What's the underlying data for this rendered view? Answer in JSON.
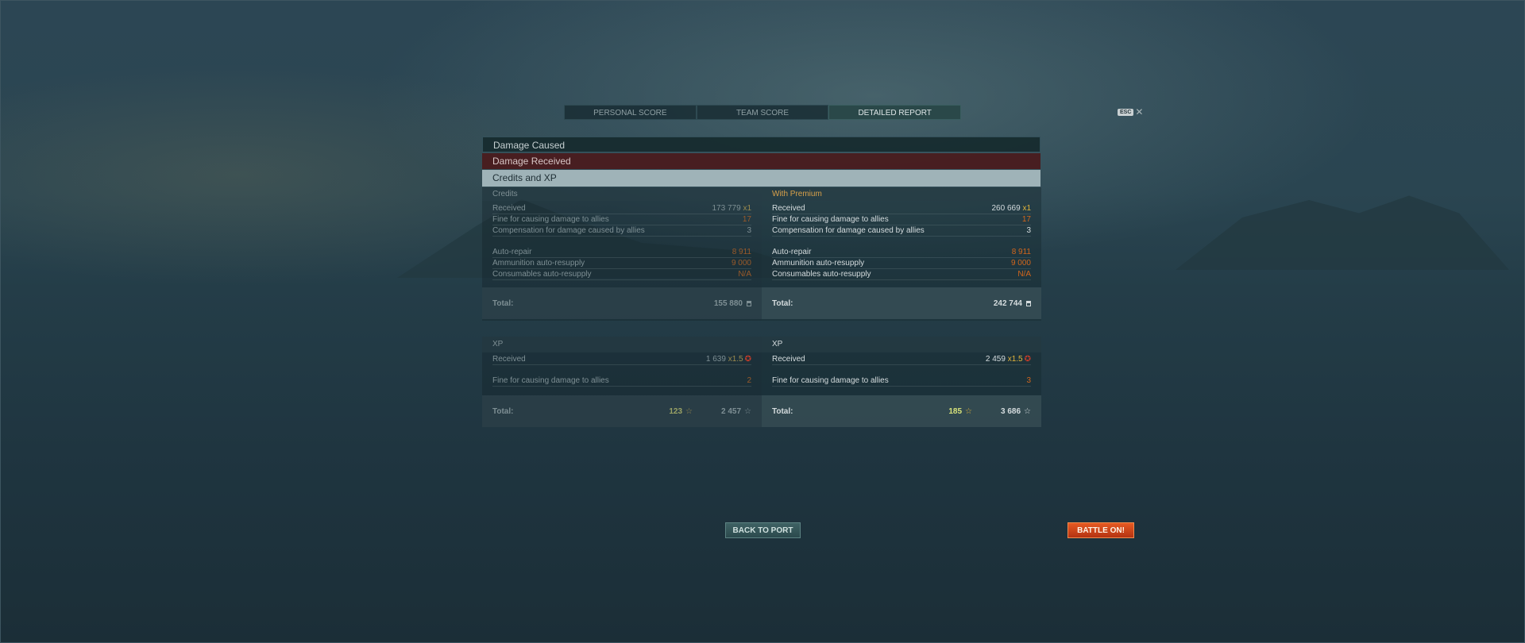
{
  "tabs": [
    {
      "label": "PERSONAL SCORE"
    },
    {
      "label": "TEAM SCORE"
    },
    {
      "label": "DETAILED REPORT"
    }
  ],
  "esc": {
    "key": "ESC",
    "close": "✕"
  },
  "sections": {
    "caused": "Damage Caused",
    "received": "Damage Received",
    "credits": "Credits and XP"
  },
  "credits": {
    "header": "Credits",
    "rows": [
      {
        "label": "Received",
        "value": "173 779",
        "mult": "x1"
      },
      {
        "label": "Fine for causing damage to allies",
        "value": "17"
      },
      {
        "label": "Compensation for damage caused by allies",
        "value": "3"
      },
      {
        "label": "Auto-repair",
        "value": "8 911"
      },
      {
        "label": "Ammunition auto-resupply",
        "value": "9 000"
      },
      {
        "label": "Consumables auto-resupply",
        "value": "N/A"
      }
    ],
    "total_label": "Total:",
    "total": "155 880"
  },
  "premium": {
    "header": "With Premium",
    "rows": [
      {
        "label": "Received",
        "value": "260 669",
        "mult": "x1"
      },
      {
        "label": "Fine for causing damage to allies",
        "value": "17"
      },
      {
        "label": "Compensation for damage caused by allies",
        "value": "3"
      },
      {
        "label": "Auto-repair",
        "value": "8 911"
      },
      {
        "label": "Ammunition auto-resupply",
        "value": "9 000"
      },
      {
        "label": "Consumables auto-resupply",
        "value": "N/A"
      }
    ],
    "total_label": "Total:",
    "total": "242 744"
  },
  "xp": {
    "header": "XP",
    "received_label": "Received",
    "received_value": "1 639",
    "received_mult": "x1.5",
    "fine_label": "Fine for causing damage to allies",
    "fine_value": "2",
    "total_label": "Total:",
    "total_free": "123",
    "total_xp": "2 457"
  },
  "xp_premium": {
    "header": "XP",
    "received_label": "Received",
    "received_value": "2 459",
    "received_mult": "x1.5",
    "fine_label": "Fine for causing damage to allies",
    "fine_value": "3",
    "total_label": "Total:",
    "total_free": "185",
    "total_xp": "3 686"
  },
  "buttons": {
    "back": "BACK TO PORT",
    "battle": "BATTLE ON!"
  },
  "icons": {
    "credit": "credit-icon",
    "free_xp": "free-xp-star-icon",
    "xp": "xp-star-icon",
    "multiplier": "xp-multiplier-icon"
  },
  "colors": {
    "accent_orange": "#d2661c",
    "premium_yellow": "#e3b43a",
    "battle_button": "#d8481a"
  }
}
